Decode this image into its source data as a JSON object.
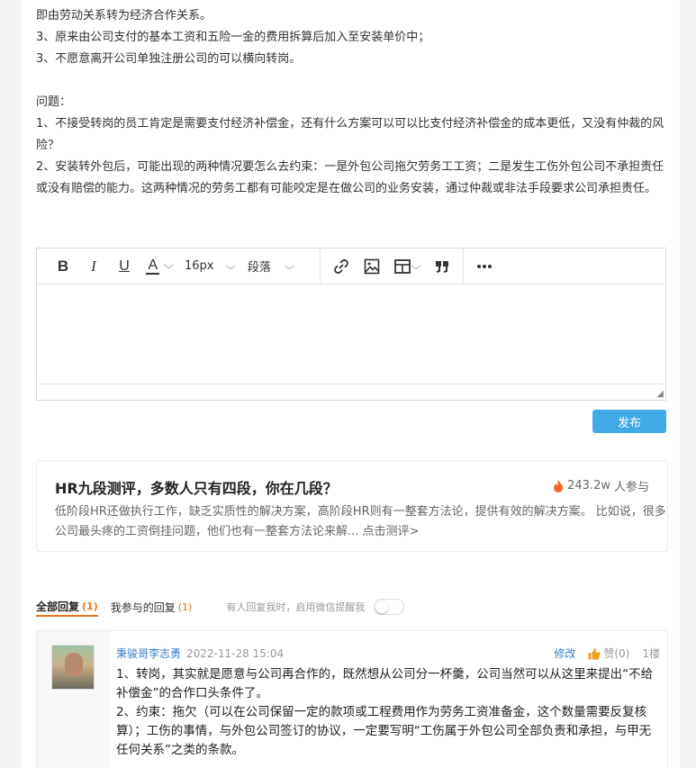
{
  "post": {
    "lines": [
      "即由劳动关系转为经济合作关系。",
      "3、原来由公司支付的基本工资和五险一金的费用拆算后加入至安装单价中；",
      "3、不愿意离开公司单独注册公司的可以横向转岗。"
    ],
    "question_heading": "问题：",
    "questions": [
      "1、不接受转岗的员工肯定是需要支付经济补偿金，还有什么方案可以可以比支付经济补偿金的成本更低，又没有仲裁的风险？",
      "2、安装转外包后，可能出现的两种情况要怎么去约束：一是外包公司拖欠劳务工工资；二是发生工伤外包公司不承担责任或没有赔偿的能力。这两种情况的劳务工都有可能咬定是在做公司的业务安装，通过仲裁或非法手段要求公司承担责任。"
    ]
  },
  "editor": {
    "toolbar": {
      "bold": "B",
      "italic": "I",
      "underline": "U",
      "font_color": "A",
      "font_size": "16px",
      "paragraph": "段落"
    },
    "icons": [
      "link-icon",
      "image-icon",
      "table-icon",
      "quote-icon",
      "more-icon"
    ],
    "publish_label": "发布"
  },
  "promo": {
    "title": "HR九段测评，多数人只有四段，你在几段？",
    "participants": "243.2w",
    "participants_suffix": "人参与",
    "description": "低阶段HR还做执行工作，缺乏实质性的解决方案，高阶段HR则有一整套方法论，提供有效的解决方案。 比如说，很多公司最头疼的工资倒挂问题，他们也有一整套方法论来解... 点击测评>"
  },
  "tabs": {
    "all_label": "全部回复",
    "all_count": "(1)",
    "mine_label": "我参与的回复",
    "mine_count": "(1)",
    "notify_label": "有人回复我时，启用微信提醒我",
    "notify_on": false
  },
  "comment": {
    "user": "秉骏哥李志勇",
    "time": "2022-11-28 15:04",
    "edit_label": "修改",
    "like_label": "赞(0)",
    "floor": "1楼",
    "body": [
      "1、转岗，其实就是愿意与公司再合作的，既然想从公司分一杯羹，公司当然可以从这里来提出“不给补偿金”的合作口头条件了。",
      "2、约束：拖欠（可以在公司保留一定的款项或工程费用作为劳务工资准备金，这个数量需要反复核算）；工伤的事情，与外包公司签订的协议，一定要写明“工伤属于外包公司全部负责和承担，与甲无任何关系”之类的条款。"
    ]
  },
  "colors": {
    "accent": "#40a9e6",
    "tab_active": "#e8741c",
    "link": "#3a7cc4",
    "fire": "#f5642b"
  }
}
